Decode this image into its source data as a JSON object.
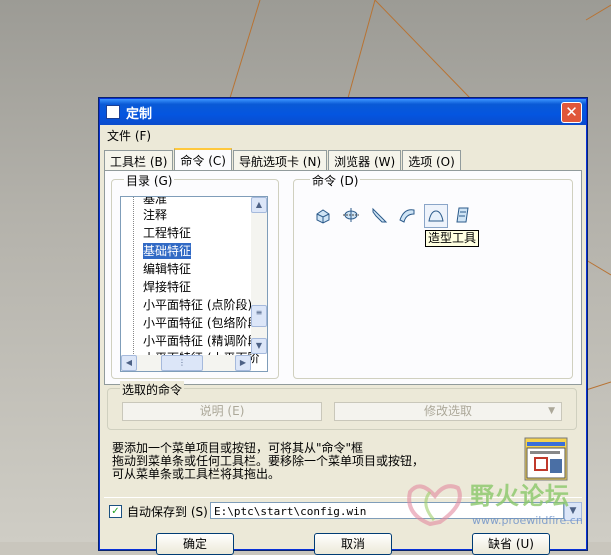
{
  "dialog": {
    "title": "定制",
    "close_glyph": "✕"
  },
  "menubar": {
    "file": "文件 (F)"
  },
  "tabs": [
    {
      "label": "工具栏 (B)"
    },
    {
      "label": "命令 (C)"
    },
    {
      "label": "导航选项卡 (N)"
    },
    {
      "label": "浏览器 (W)"
    },
    {
      "label": "选项 (O)"
    }
  ],
  "catalog": {
    "label": "目录 (G)",
    "items": [
      "基准",
      "注释",
      "工程特征",
      "基础特征",
      "编辑特征",
      "焊接特征",
      "小平面特征 (点阶段)",
      "小平面特征 (包络阶段",
      "小平面特征 (精调阶段",
      "小平面特征 (小平面阶"
    ],
    "selected_index": 3
  },
  "commands": {
    "label": "命令 (D)",
    "icons": [
      "extrude-icon",
      "revolve-icon",
      "sweep-icon",
      "blend-icon",
      "style-icon",
      "variable-section-icon"
    ],
    "tooltip": "造型工具"
  },
  "selected_command": {
    "label": "选取的命令",
    "describe_button": "说明 (E)",
    "modify_button": "修改选取"
  },
  "info_text": [
    "要添加一个菜单项目或按钮，可将其从\"命令\"框",
    "拖动到菜单条或任何工具栏。要移除一个菜单项目或按钮，",
    "可从菜单条或工具栏将其拖出。"
  ],
  "autosave": {
    "label": "自动保存到 (S)",
    "checked": true,
    "path": "E:\\ptc\\start\\config.win"
  },
  "buttons": {
    "ok": "确定",
    "cancel": "取消",
    "default": "缺省 (U)"
  },
  "watermark": {
    "title": "野火论坛",
    "url": "www.proewildfire.cn"
  }
}
